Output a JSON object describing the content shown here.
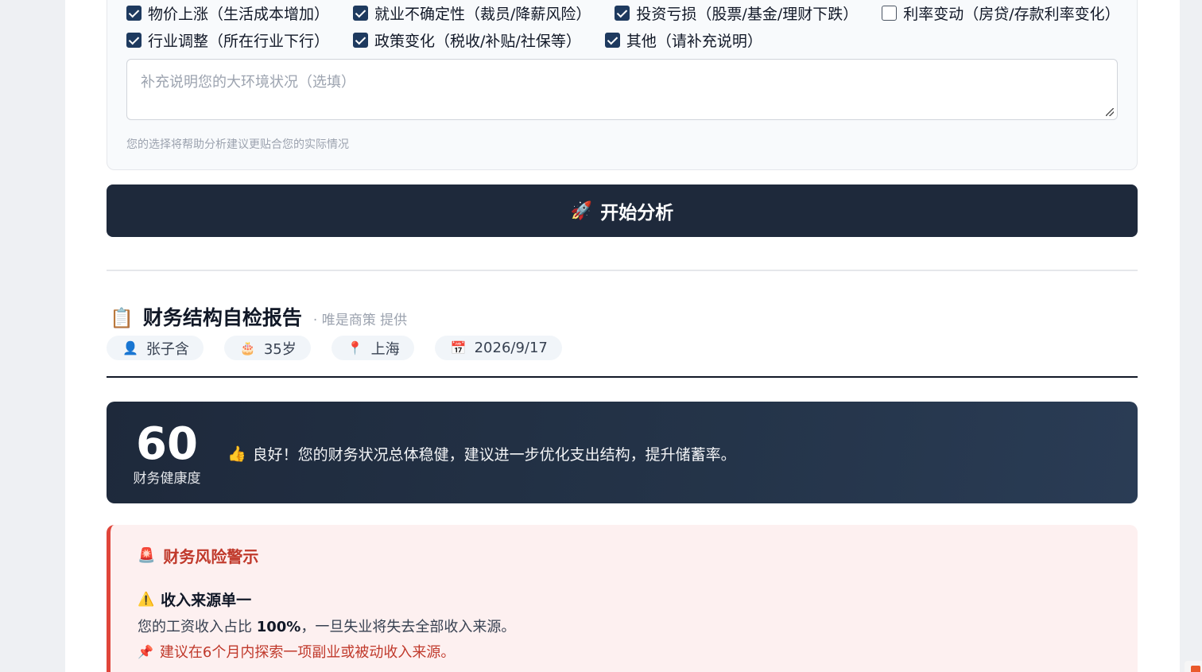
{
  "environment": {
    "row1": [
      {
        "label": "物价上涨（生活成本增加）",
        "checked": true
      },
      {
        "label": "就业不确定性（裁员/降薪风险）",
        "checked": true
      },
      {
        "label": "投资亏损（股票/基金/理财下跌）",
        "checked": true
      },
      {
        "label": "利率变动（房贷/存款利率变化）",
        "checked": false
      }
    ],
    "row2": [
      {
        "label": "行业调整（所在行业下行）",
        "checked": true
      },
      {
        "label": "政策变化（税收/补贴/社保等）",
        "checked": true
      },
      {
        "label": "其他（请补充说明）",
        "checked": true
      }
    ],
    "note_placeholder": "补充说明您的大环境状况（选填）",
    "hint": "您的选择将帮助分析建议更贴合您的实际情况"
  },
  "start_button": {
    "icon": "🚀",
    "label": "开始分析"
  },
  "report": {
    "icon": "📋",
    "title": "财务结构自检报告",
    "provider": "· 唯是商策 提供",
    "chips": [
      {
        "icon": "👤",
        "text": "张子含",
        "name": "user"
      },
      {
        "icon": "🎂",
        "text": "35岁",
        "name": "age"
      },
      {
        "icon": "📍",
        "text": "上海",
        "name": "location"
      },
      {
        "icon": "📅",
        "text": "2026/9/17",
        "name": "date"
      }
    ]
  },
  "score": {
    "value": "60",
    "label": "财务健康度",
    "icon": "👍",
    "message": "良好！您的财务状况总体稳健，建议进一步优化支出结构，提升储蓄率。"
  },
  "risk": {
    "icon": "🚨",
    "title": "财务风险警示",
    "item": {
      "icon": "⚠️",
      "title": "收入来源单一",
      "desc_prefix": "您的工资收入占比 ",
      "desc_bold": "100%",
      "desc_suffix": "，一旦失业将失去全部收入来源。",
      "tip_icon": "📌",
      "tip": "建议在6个月内探索一项副业或被动收入来源。"
    }
  },
  "colors": {
    "primary": "#1e293b",
    "danger": "#c0392b",
    "danger_border": "#e0453a",
    "risk_bg": "#fdf0f0"
  }
}
